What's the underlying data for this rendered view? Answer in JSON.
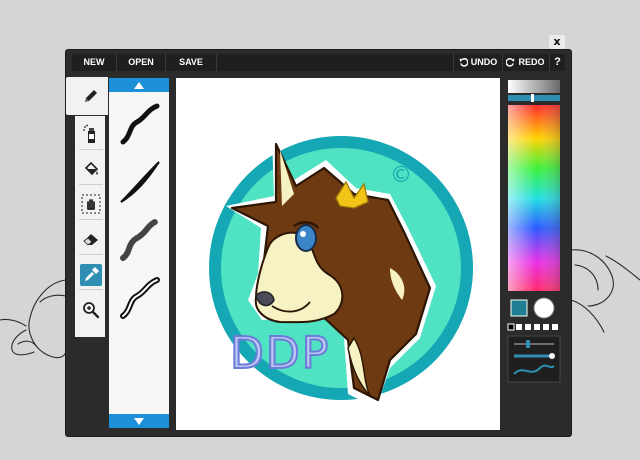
{
  "window": {
    "close_label": "x"
  },
  "toolbar": {
    "new_label": "NEW",
    "open_label": "OPEN",
    "save_label": "SAVE",
    "undo_label": "UNDO",
    "redo_label": "REDO",
    "help_label": "?"
  },
  "tools": [
    {
      "name": "pencil",
      "icon": "pencil-icon",
      "selected": false
    },
    {
      "name": "spray",
      "icon": "spray-can-icon",
      "selected": false
    },
    {
      "name": "fill",
      "icon": "paint-bucket-icon",
      "selected": false
    },
    {
      "name": "select-move",
      "icon": "hand-select-icon",
      "selected": false
    },
    {
      "name": "eraser",
      "icon": "eraser-icon",
      "selected": false
    },
    {
      "name": "eyedropper",
      "icon": "eyedropper-icon",
      "selected": true
    },
    {
      "name": "zoom",
      "icon": "zoom-icon",
      "selected": false
    }
  ],
  "brushes": [
    "smooth-stroke",
    "tapered-stroke",
    "dotted-stroke",
    "outlined-stroke"
  ],
  "colors": {
    "primary": "#1e7f92",
    "secondary": "#ffffff",
    "accent": "#1e8fd9",
    "tool_selected": "#2f8fb2",
    "palette": [
      "#000000",
      "#ffffff",
      "#ffffff",
      "#ffffff",
      "#ffffff",
      "#ffffff"
    ]
  },
  "canvas": {
    "copyright_mark": "©",
    "signature_text": "DDP",
    "palette_colors": [
      "#6d3a12",
      "#f6f2c4",
      "#4fe3c3",
      "#16a7b4",
      "#3a86c8",
      "#f2c418"
    ]
  }
}
